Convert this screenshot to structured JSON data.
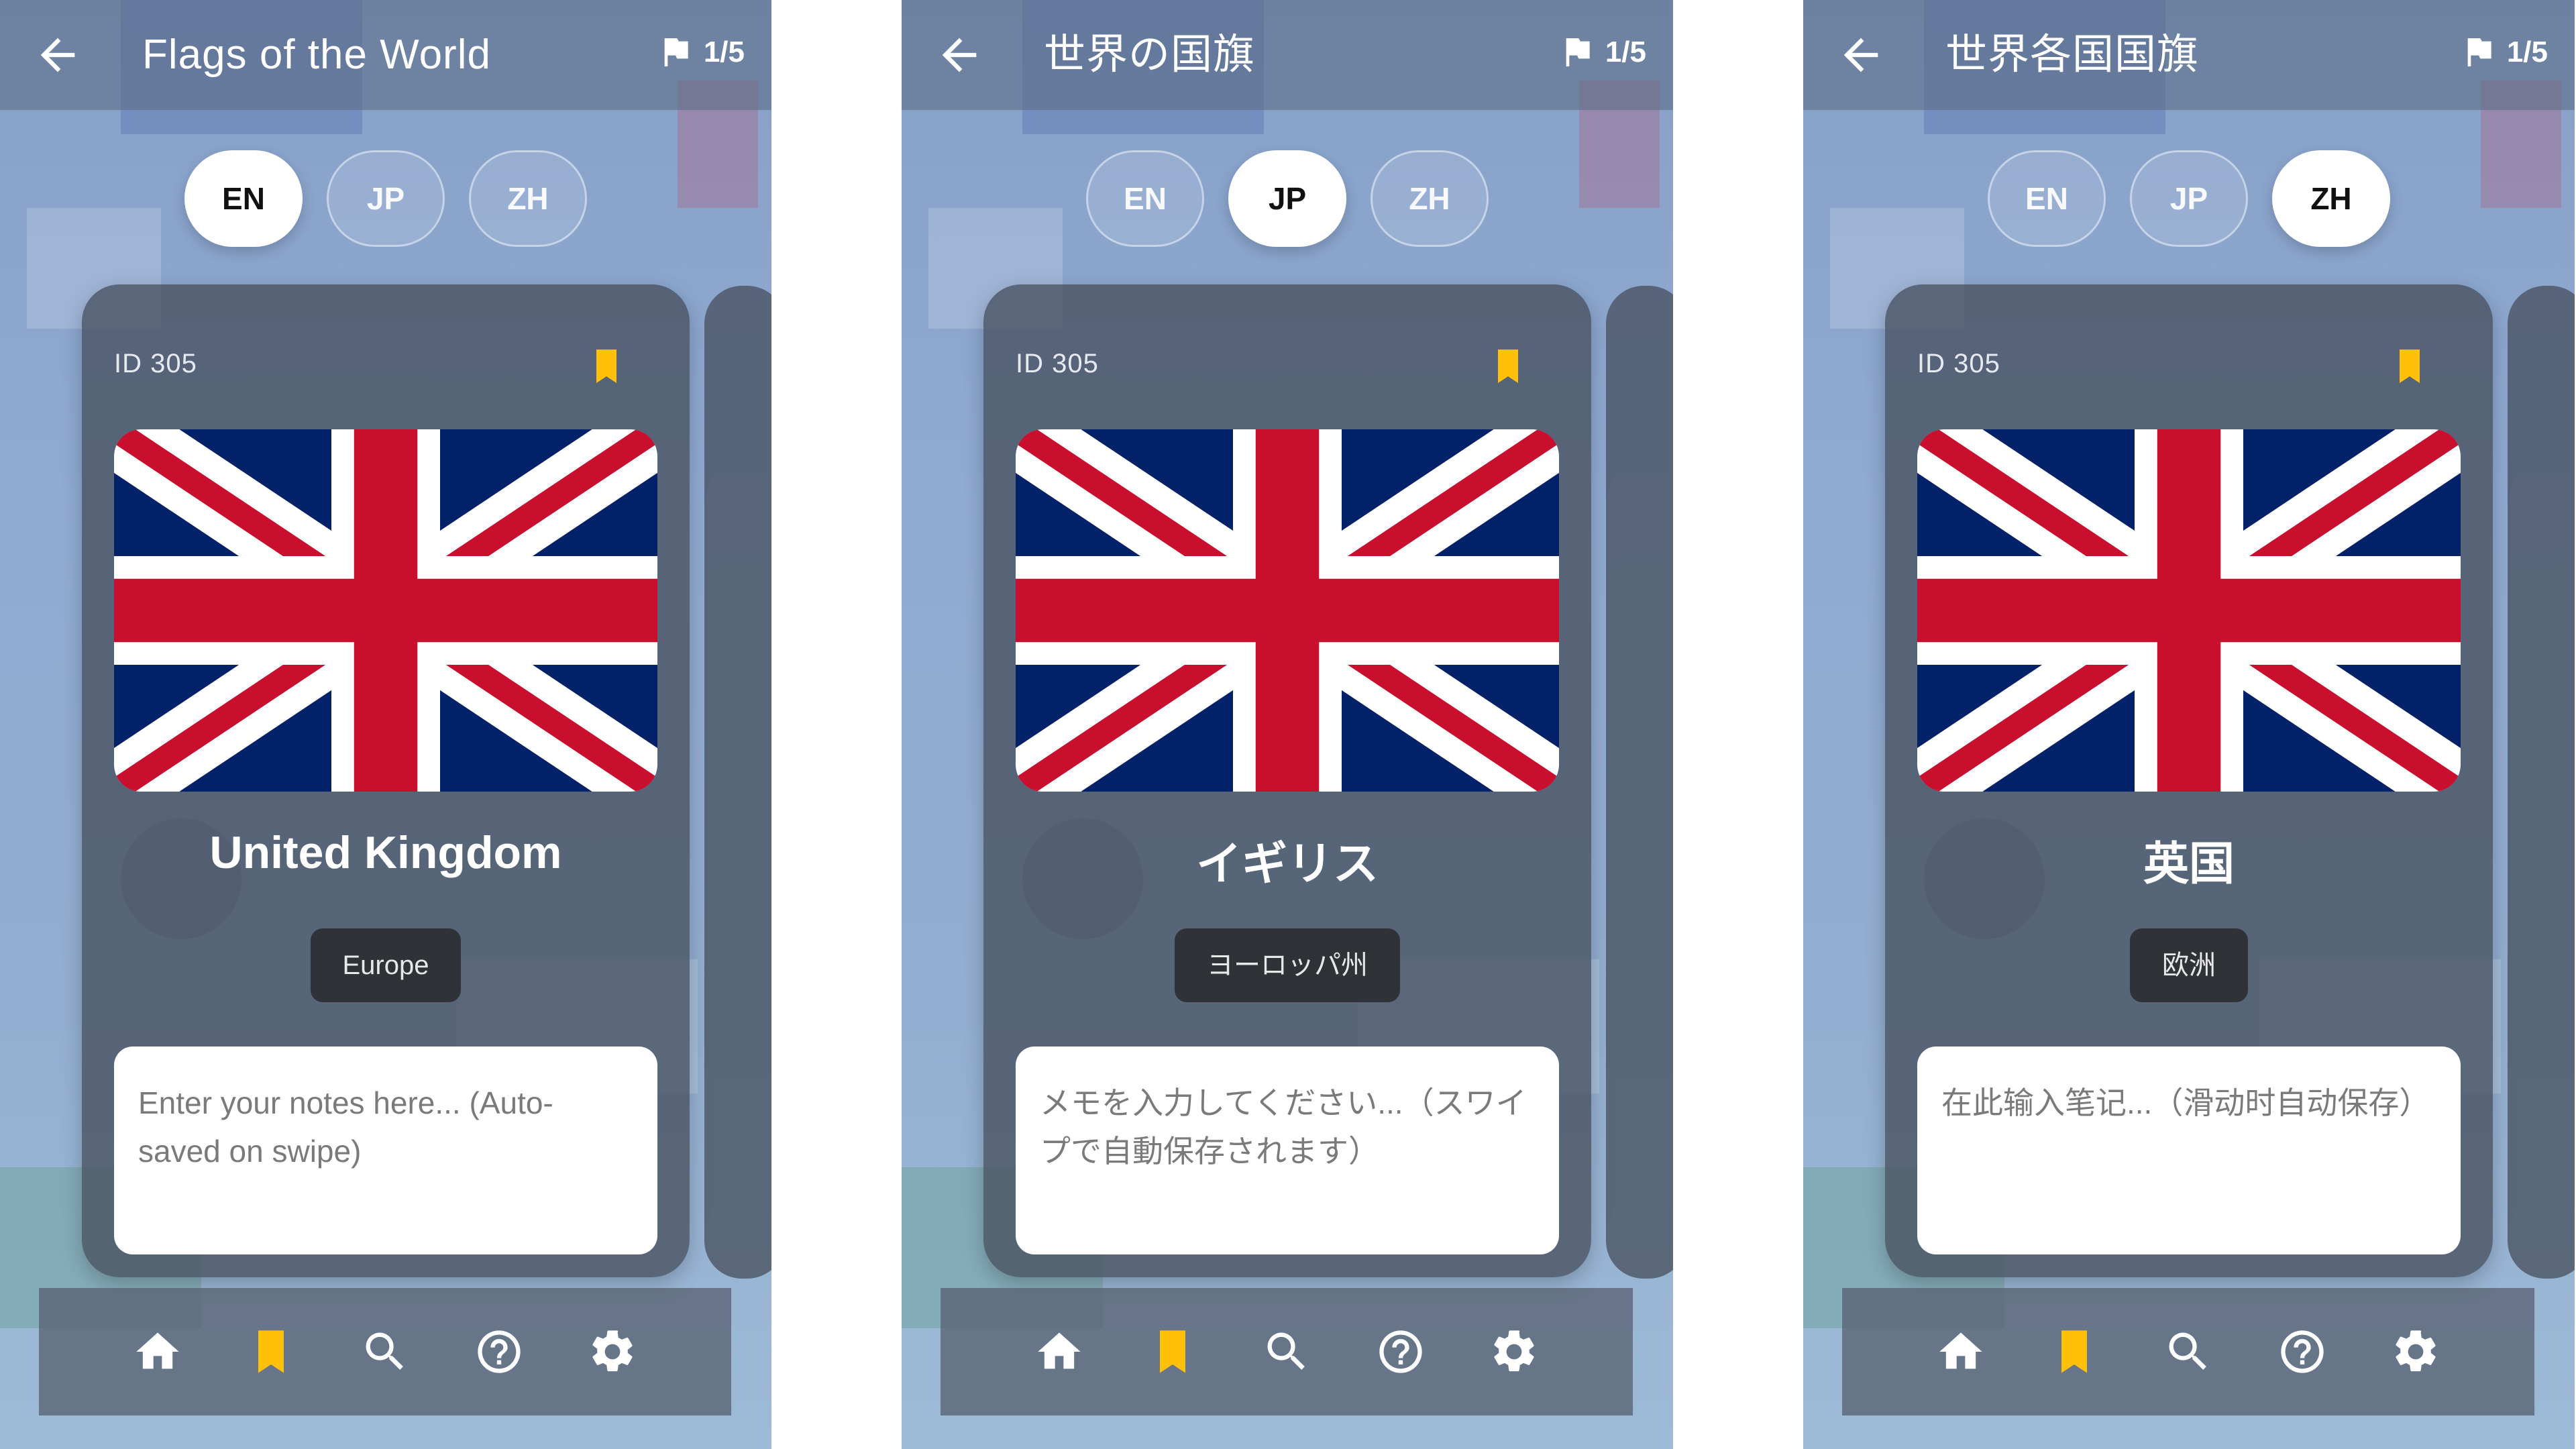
{
  "screens": [
    {
      "title": "Flags of the World",
      "counter": "1/5",
      "languages": [
        {
          "code": "EN",
          "active": true
        },
        {
          "code": "JP",
          "active": false
        },
        {
          "code": "ZH",
          "active": false
        }
      ],
      "card": {
        "id_label": "ID 305",
        "country": "United Kingdom",
        "region": "Europe",
        "notes_placeholder": "Enter your notes here... (Auto-saved on swipe)",
        "bookmarked": true
      }
    },
    {
      "title": "世界の国旗",
      "counter": "1/5",
      "languages": [
        {
          "code": "EN",
          "active": false
        },
        {
          "code": "JP",
          "active": true
        },
        {
          "code": "ZH",
          "active": false
        }
      ],
      "card": {
        "id_label": "ID 305",
        "country": "イギリス",
        "region": "ヨーロッパ州",
        "notes_placeholder": "メモを入力してください...（スワイプで自動保存されます）",
        "bookmarked": true
      }
    },
    {
      "title": "世界各国国旗",
      "counter": "1/5",
      "languages": [
        {
          "code": "EN",
          "active": false
        },
        {
          "code": "JP",
          "active": false
        },
        {
          "code": "ZH",
          "active": true
        }
      ],
      "card": {
        "id_label": "ID 305",
        "country": "英国",
        "region": "欧洲",
        "notes_placeholder": "在此输入笔记...（滑动时自动保存）",
        "bookmarked": true
      }
    }
  ],
  "nav": {
    "items": [
      {
        "icon": "home-icon",
        "active": false
      },
      {
        "icon": "bookmark-icon",
        "active": true
      },
      {
        "icon": "search-icon",
        "active": false
      },
      {
        "icon": "help-icon",
        "active": false
      },
      {
        "icon": "settings-icon",
        "active": false
      }
    ]
  },
  "colors": {
    "bookmark_accent": "#FFC107",
    "flag_blue": "#012169",
    "flag_red": "#C8102E",
    "flag_white": "#FFFFFF",
    "card_bg": "#48525E",
    "region_bg": "#2F3338"
  }
}
